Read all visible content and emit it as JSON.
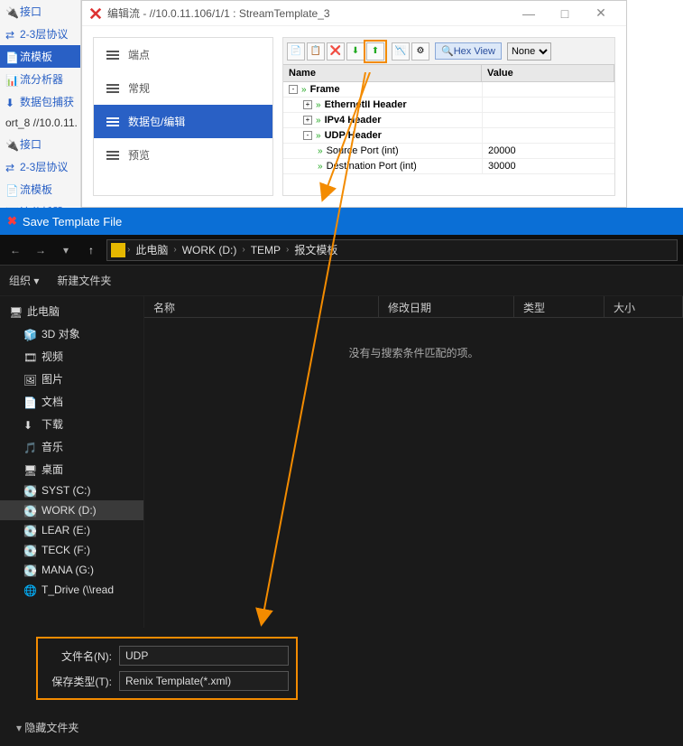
{
  "left_nav": {
    "items": [
      {
        "label": "接口"
      },
      {
        "label": "2-3层协议"
      },
      {
        "label": "流模板",
        "active": true
      },
      {
        "label": "流分析器"
      },
      {
        "label": "数据包捕获"
      },
      {
        "label": "ort_8 //10.0.11."
      },
      {
        "label": "接口"
      },
      {
        "label": "2-3层协议"
      },
      {
        "label": "流模板"
      },
      {
        "label": "流分析器"
      }
    ]
  },
  "editor": {
    "title": "编辑流 - //10.0.11.106/1/1 : StreamTemplate_3",
    "sidebar": [
      {
        "label": "端点"
      },
      {
        "label": "常规"
      },
      {
        "label": "数据包/编辑",
        "active": true
      },
      {
        "label": "预览"
      }
    ],
    "toolbar": {
      "hex_label": "Hex View",
      "select_value": "None"
    },
    "tree": {
      "headers": [
        "Name",
        "Value"
      ],
      "rows": [
        {
          "indent": 0,
          "toggle": "-",
          "label": "Frame",
          "value": "",
          "bold": true
        },
        {
          "indent": 1,
          "toggle": "+",
          "label": "EthernetII Header",
          "value": "",
          "bold": true
        },
        {
          "indent": 1,
          "toggle": "+",
          "label": "IPv4 Header",
          "value": "",
          "bold": true
        },
        {
          "indent": 1,
          "toggle": "-",
          "label": "UDP Header",
          "value": "",
          "bold": true
        },
        {
          "indent": 2,
          "toggle": "",
          "label": "Source Port (int)",
          "value": "20000",
          "bold": false
        },
        {
          "indent": 2,
          "toggle": "",
          "label": "Destination Port (int)",
          "value": "30000",
          "bold": false
        }
      ]
    }
  },
  "save_dialog": {
    "title": "Save Template File",
    "breadcrumb": [
      "此电脑",
      "WORK (D:)",
      "TEMP",
      "报文模板"
    ],
    "toolbar": {
      "organize": "组织",
      "arrow": "▾",
      "new_folder": "新建文件夹"
    },
    "folder_tree": [
      {
        "label": "此电脑",
        "icon": "pc",
        "indent": 0
      },
      {
        "label": "3D 对象",
        "icon": "3d",
        "indent": 1
      },
      {
        "label": "视频",
        "icon": "video",
        "indent": 1
      },
      {
        "label": "图片",
        "icon": "image",
        "indent": 1
      },
      {
        "label": "文档",
        "icon": "doc",
        "indent": 1
      },
      {
        "label": "下载",
        "icon": "download",
        "indent": 1
      },
      {
        "label": "音乐",
        "icon": "music",
        "indent": 1
      },
      {
        "label": "桌面",
        "icon": "desktop",
        "indent": 1
      },
      {
        "label": "SYST (C:)",
        "icon": "drive",
        "indent": 1
      },
      {
        "label": "WORK (D:)",
        "icon": "drive",
        "indent": 1,
        "selected": true
      },
      {
        "label": "LEAR (E:)",
        "icon": "drive",
        "indent": 1
      },
      {
        "label": "TECK (F:)",
        "icon": "drive",
        "indent": 1
      },
      {
        "label": "MANA (G:)",
        "icon": "drive",
        "indent": 1
      },
      {
        "label": "T_Drive (\\\\read",
        "icon": "netdrive",
        "indent": 1
      }
    ],
    "file_list": {
      "headers": {
        "name": "名称",
        "modified": "修改日期",
        "type": "类型",
        "size": "大小"
      },
      "empty_text": "没有与搜索条件匹配的项。"
    },
    "footer": {
      "filename_label": "文件名(N):",
      "filename_value": "UDP",
      "filetype_label": "保存类型(T):",
      "filetype_value": "Renix Template(*.xml)"
    },
    "hidden_folders": "隐藏文件夹"
  }
}
